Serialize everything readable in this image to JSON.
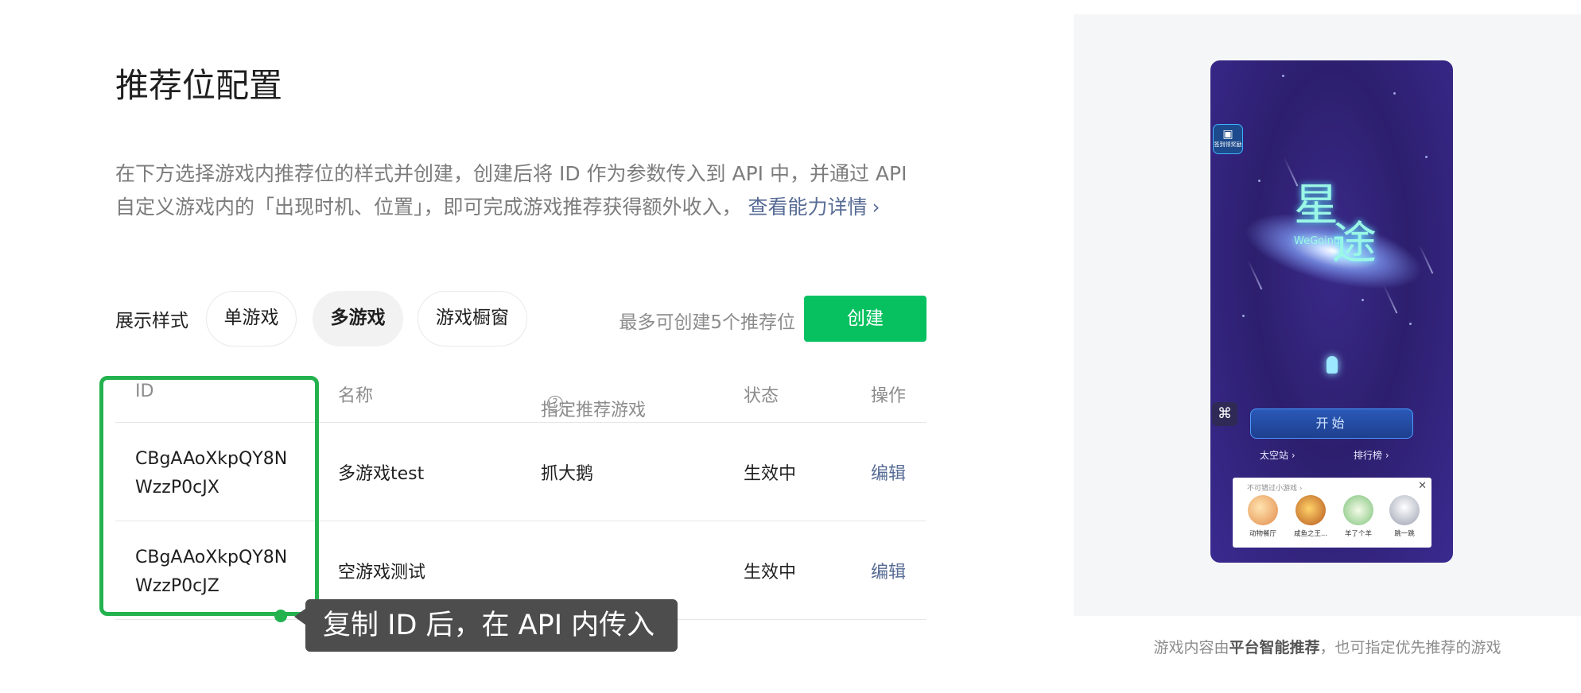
{
  "header": {
    "title": "推荐位配置"
  },
  "description": {
    "text": "在下方选择游戏内推荐位的样式并创建，创建后将 ID 作为参数传入到 API 中，并通过 API 自定义游戏内的「出现时机、位置」，即可完成游戏推荐获得额外收入，",
    "link_label": "查看能力详情",
    "link_chevron": "›"
  },
  "style_selector": {
    "label": "展示样式",
    "options": [
      {
        "label": "单游戏",
        "active": false
      },
      {
        "label": "多游戏",
        "active": true
      },
      {
        "label": "游戏橱窗",
        "active": false
      }
    ],
    "limit_text": "最多可创建5个推荐位",
    "create_label": "创建"
  },
  "table": {
    "columns": {
      "id": "ID",
      "name": "名称",
      "game": "指定推荐游戏",
      "game_help": "?",
      "status": "状态",
      "action": "操作"
    },
    "rows": [
      {
        "id": "CBgAAoXkpQY8NWzzP0cJX",
        "name": "多游戏test",
        "game": "抓大鹅",
        "status": "生效中",
        "action": "编辑"
      },
      {
        "id": "CBgAAoXkpQY8NWzzP0cJZ",
        "name": "空游戏测试",
        "game": "",
        "status": "生效中",
        "action": "编辑"
      }
    ]
  },
  "tooltip": {
    "text": "复制 ID 后，在 API 内传入"
  },
  "preview": {
    "badge_text": "签到领奖励",
    "badge_icon": "gift-icon",
    "logo_line1": "星",
    "logo_line2": "途",
    "logo_sub": "WeGoing",
    "gamepad_icon": "gamepad-icon",
    "start_label": "开始",
    "link_station": "太空站 ›",
    "link_rank": "排行榜 ›",
    "reco_title": "不可错过小游戏 ›",
    "reco_close": "✕",
    "reco_items": [
      {
        "name": "动物餐厅"
      },
      {
        "name": "咸鱼之王..."
      },
      {
        "name": "羊了个羊"
      },
      {
        "name": "跳一跳"
      }
    ]
  },
  "caption": {
    "prefix": "游戏内容由",
    "bold": "平台智能推荐",
    "suffix": "，也可指定优先推荐的游戏"
  },
  "colors": {
    "accent_green": "#07c160",
    "link_blue": "#576b95",
    "highlight_green": "#24b24f",
    "tooltip_bg": "#4d4d4d"
  }
}
